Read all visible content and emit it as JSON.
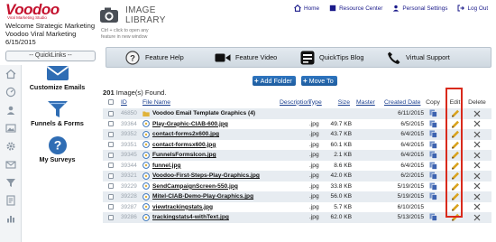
{
  "brand": {
    "logo_text": "Voodoo",
    "logo_tagline": "Viral Marketing Studio",
    "accent_color": "#c4122e"
  },
  "welcome": {
    "line1": "Welcome Strategic Marketing",
    "line2": "Voodoo Viral Marketing",
    "date": "6/15/2015"
  },
  "quicklinks": {
    "label": "-- QuickLinks --"
  },
  "leftnav": {
    "rail_icons": [
      "home-icon",
      "dashboard-icon",
      "people-icon",
      "image-icon",
      "gear-icon",
      "envelope-icon",
      "funnel-icon",
      "survey-icon",
      "chart-icon"
    ],
    "items": [
      {
        "label": "Customize Emails",
        "icon": "envelope-icon"
      },
      {
        "label": "Funnels & Forms",
        "icon": "funnel-icon"
      },
      {
        "label": "My Surveys",
        "icon": "question-icon"
      }
    ]
  },
  "library": {
    "title_line1": "IMAGE",
    "title_line2": "LIBRARY",
    "hint_line1": "Ctrl + click to open any",
    "hint_line2": "feature in new window"
  },
  "topnav": {
    "home": "Home",
    "resource_center": "Resource Center",
    "personal_settings": "Personal Settings",
    "logout": "Log Out"
  },
  "helpbar": {
    "feature_help": "Feature Help",
    "feature_video": "Feature Video",
    "quicktips_blog": "QuickTips Blog",
    "virtual_support": "Virtual Support"
  },
  "actions": {
    "add_folder": "Add Folder",
    "move_to": "Move To"
  },
  "count": {
    "number": "201",
    "text": "Image(s) Found."
  },
  "table": {
    "headers": {
      "id": "ID",
      "file_name": "File Name",
      "description": "Description",
      "type": "Type",
      "size": "Size",
      "master": "Master",
      "created_date": "Created Date",
      "copy": "Copy",
      "edit": "Edit",
      "delete": "Delete"
    },
    "rows": [
      {
        "id": "46850",
        "name": "Voodoo Email Template Graphics (4)",
        "kind": "folder",
        "type": "",
        "size": "",
        "date": "6/11/2015",
        "copy": true,
        "edit": true
      },
      {
        "id": "39364",
        "name": "Play-Graphic-CIAB-600.jpg",
        "kind": "image",
        "type": ".jpg",
        "size": "49.7 KB",
        "date": "6/5/2015",
        "copy": true,
        "edit": true
      },
      {
        "id": "39352",
        "name": "contact-forms2x600.jpg",
        "kind": "image",
        "type": ".jpg",
        "size": "43.7 KB",
        "date": "6/4/2015",
        "copy": true,
        "edit": true
      },
      {
        "id": "39351",
        "name": "contact-formsx600.jpg",
        "kind": "image",
        "type": ".jpg",
        "size": "60.1 KB",
        "date": "6/4/2015",
        "copy": true,
        "edit": true
      },
      {
        "id": "39345",
        "name": "FunnelsFormsIcon.jpg",
        "kind": "image",
        "type": ".jpg",
        "size": "2.1 KB",
        "date": "6/4/2015",
        "copy": true,
        "edit": true
      },
      {
        "id": "39344",
        "name": "funnel.jpg",
        "kind": "image",
        "type": ".jpg",
        "size": "8.6 KB",
        "date": "6/4/2015",
        "copy": true,
        "edit": true
      },
      {
        "id": "39321",
        "name": "Voodoo-First-Steps-Play-Graphics.jpg",
        "kind": "image",
        "type": ".jpg",
        "size": "42.0 KB",
        "date": "6/2/2015",
        "copy": true,
        "edit": true
      },
      {
        "id": "39229",
        "name": "SendCampaignScreen-550.jpg",
        "kind": "image",
        "type": ".jpg",
        "size": "33.8 KB",
        "date": "5/19/2015",
        "copy": true,
        "edit": true
      },
      {
        "id": "39228",
        "name": "Mitel-CIAB-Demo-Play-Graphics.jpg",
        "kind": "image",
        "type": ".jpg",
        "size": "56.0 KB",
        "date": "5/19/2015",
        "copy": true,
        "edit": true
      },
      {
        "id": "39287",
        "name": "viewtrackingstats.jpg",
        "kind": "image",
        "type": ".jpg",
        "size": "5.7 KB",
        "date": "6/10/2015",
        "copy": false,
        "edit": true
      },
      {
        "id": "39286",
        "name": "trackingstats4-withText.jpg",
        "kind": "image",
        "type": ".jpg",
        "size": "62.0 KB",
        "date": "5/13/2015",
        "copy": true,
        "edit": true
      }
    ]
  },
  "colors": {
    "link": "#1a1a8a",
    "button": "#2f76c0",
    "highlight": "#d92a1c",
    "row_alt": "#e7ecf1",
    "pencil": "#d9a21c"
  }
}
